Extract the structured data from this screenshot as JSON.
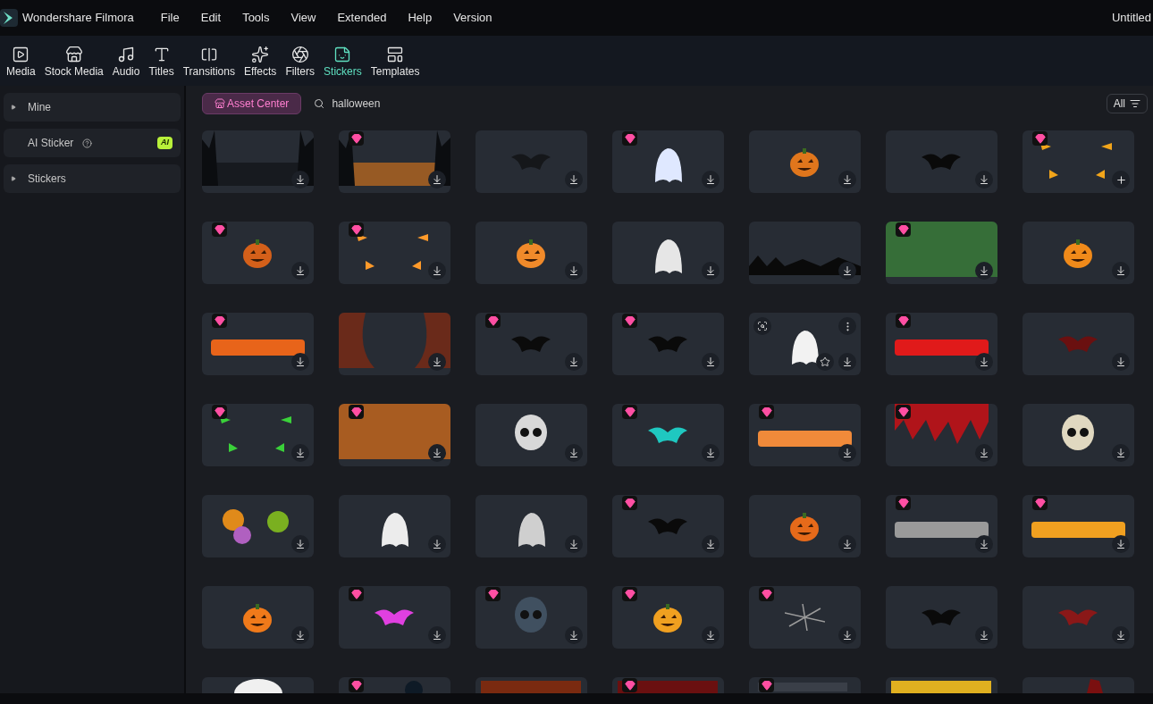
{
  "app": {
    "name": "Wondershare Filmora",
    "menu": [
      "File",
      "Edit",
      "Tools",
      "View",
      "Extended",
      "Help",
      "Version"
    ],
    "project_title": "Untitled"
  },
  "toolbar": [
    {
      "label": "Media",
      "selected": false
    },
    {
      "label": "Stock Media",
      "selected": false
    },
    {
      "label": "Audio",
      "selected": false
    },
    {
      "label": "Titles",
      "selected": false
    },
    {
      "label": "Transitions",
      "selected": false
    },
    {
      "label": "Effects",
      "selected": false
    },
    {
      "label": "Filters",
      "selected": false
    },
    {
      "label": "Stickers",
      "selected": true
    },
    {
      "label": "Templates",
      "selected": false
    }
  ],
  "sidebar": [
    {
      "label": "Mine",
      "kind": "group"
    },
    {
      "label": "AI Sticker",
      "kind": "ai",
      "badge": "AI"
    },
    {
      "label": "Stickers",
      "kind": "group"
    }
  ],
  "asset_center": "Asset Center",
  "search": {
    "value": "halloween"
  },
  "filter": "All",
  "stickers": [
    {
      "premium": false,
      "hovered": false,
      "kind": "download"
    },
    {
      "premium": true,
      "hovered": false,
      "kind": "download"
    },
    {
      "premium": false,
      "hovered": false,
      "kind": "download"
    },
    {
      "premium": true,
      "hovered": false,
      "kind": "download"
    },
    {
      "premium": false,
      "hovered": false,
      "kind": "download"
    },
    {
      "premium": false,
      "hovered": false,
      "kind": "download"
    },
    {
      "premium": true,
      "hovered": false,
      "kind": "add"
    },
    {
      "premium": true,
      "hovered": false,
      "kind": "download"
    },
    {
      "premium": true,
      "hovered": false,
      "kind": "download"
    },
    {
      "premium": false,
      "hovered": false,
      "kind": "download"
    },
    {
      "premium": false,
      "hovered": false,
      "kind": "download"
    },
    {
      "premium": false,
      "hovered": false,
      "kind": "download"
    },
    {
      "premium": true,
      "hovered": false,
      "kind": "download"
    },
    {
      "premium": false,
      "hovered": false,
      "kind": "download"
    },
    {
      "premium": true,
      "hovered": false,
      "kind": "download"
    },
    {
      "premium": false,
      "hovered": false,
      "kind": "download"
    },
    {
      "premium": true,
      "hovered": false,
      "kind": "download"
    },
    {
      "premium": true,
      "hovered": false,
      "kind": "download"
    },
    {
      "premium": false,
      "hovered": true,
      "kind": "download"
    },
    {
      "premium": true,
      "hovered": false,
      "kind": "download"
    },
    {
      "premium": false,
      "hovered": false,
      "kind": "download"
    },
    {
      "premium": true,
      "hovered": false,
      "kind": "download"
    },
    {
      "premium": true,
      "hovered": false,
      "kind": "download"
    },
    {
      "premium": false,
      "hovered": false,
      "kind": "download"
    },
    {
      "premium": true,
      "hovered": false,
      "kind": "download"
    },
    {
      "premium": true,
      "hovered": false,
      "kind": "download"
    },
    {
      "premium": true,
      "hovered": false,
      "kind": "download"
    },
    {
      "premium": false,
      "hovered": false,
      "kind": "download"
    },
    {
      "premium": false,
      "hovered": false,
      "kind": "download"
    },
    {
      "premium": false,
      "hovered": false,
      "kind": "download"
    },
    {
      "premium": false,
      "hovered": false,
      "kind": "download"
    },
    {
      "premium": true,
      "hovered": false,
      "kind": "download"
    },
    {
      "premium": false,
      "hovered": false,
      "kind": "download"
    },
    {
      "premium": true,
      "hovered": false,
      "kind": "download"
    },
    {
      "premium": true,
      "hovered": false,
      "kind": "download"
    },
    {
      "premium": false,
      "hovered": false,
      "kind": "download"
    },
    {
      "premium": true,
      "hovered": false,
      "kind": "download"
    },
    {
      "premium": true,
      "hovered": false,
      "kind": "download"
    },
    {
      "premium": true,
      "hovered": false,
      "kind": "download"
    },
    {
      "premium": true,
      "hovered": false,
      "kind": "download"
    },
    {
      "premium": false,
      "hovered": false,
      "kind": "download"
    },
    {
      "premium": false,
      "hovered": false,
      "kind": "download"
    },
    {
      "premium": false,
      "kind": "partial"
    },
    {
      "premium": true,
      "kind": "partial"
    },
    {
      "premium": false,
      "kind": "partial"
    },
    {
      "premium": true,
      "kind": "partial"
    },
    {
      "premium": true,
      "kind": "partial"
    },
    {
      "premium": false,
      "kind": "partial"
    },
    {
      "premium": false,
      "kind": "partial"
    }
  ]
}
